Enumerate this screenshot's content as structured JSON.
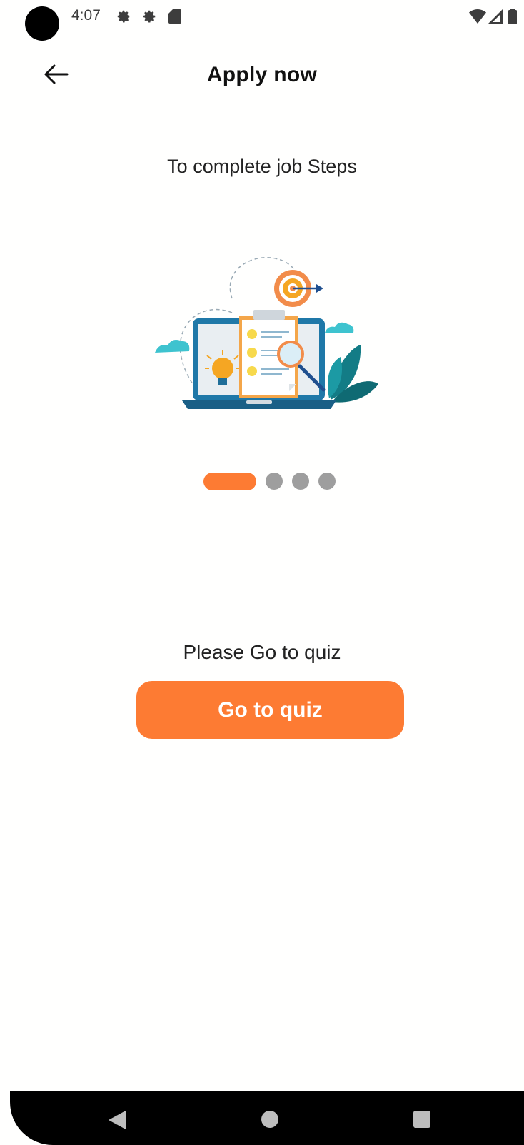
{
  "status_bar": {
    "time": "4:07",
    "icons": [
      "settings-icon",
      "settings-icon",
      "sd-card-icon",
      "wifi-icon",
      "signal-icon",
      "battery-icon"
    ]
  },
  "app_bar": {
    "title": "Apply now",
    "back_icon": "arrow-left-icon"
  },
  "content": {
    "subtitle": "To complete job Steps",
    "illustration": "laptop-checklist-illustration",
    "page_indicator": {
      "total": 4,
      "active": 1
    },
    "prompt": "Please Go to quiz",
    "button_label": "Go to quiz"
  },
  "colors": {
    "accent": "#fd7b33",
    "inactive_dot": "#9e9e9e",
    "background": "#fffffe"
  },
  "nav_bar": {
    "icons": [
      "nav-back-icon",
      "nav-home-icon",
      "nav-recents-icon"
    ]
  }
}
